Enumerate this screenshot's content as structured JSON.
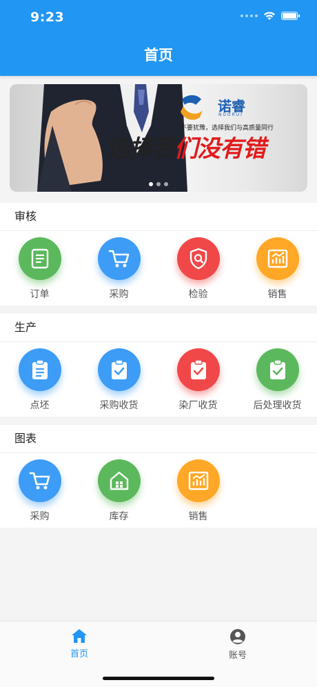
{
  "status_bar": {
    "time": "9:23"
  },
  "nav": {
    "title": "首页"
  },
  "banner": {
    "logo_text": "诺睿",
    "logo_sub": "NUORUI",
    "tagline": "不要犹豫，选择我们与高质量同行",
    "slogan_part1": "选择我",
    "slogan_part2": "们没有错",
    "page_count": 3,
    "active_page": 1
  },
  "sections": [
    {
      "title": "审核",
      "items": [
        {
          "label": "订单",
          "icon": "document-icon",
          "color": "#5cb85c"
        },
        {
          "label": "采购",
          "icon": "cart-icon",
          "color": "#3d9cf5"
        },
        {
          "label": "检验",
          "icon": "shield-search-icon",
          "color": "#f04848"
        },
        {
          "label": "销售",
          "icon": "chart-icon",
          "color": "#ffa726"
        }
      ]
    },
    {
      "title": "生产",
      "items": [
        {
          "label": "点坯",
          "icon": "clipboard-list-icon",
          "color": "#3d9cf5"
        },
        {
          "label": "采购收货",
          "icon": "clipboard-check-icon",
          "color": "#3d9cf5"
        },
        {
          "label": "染厂收货",
          "icon": "clipboard-check-icon",
          "color": "#f04848"
        },
        {
          "label": "后处理收货",
          "icon": "clipboard-check-icon",
          "color": "#5cb85c"
        }
      ]
    },
    {
      "title": "图表",
      "items": [
        {
          "label": "采购",
          "icon": "cart-icon",
          "color": "#3d9cf5"
        },
        {
          "label": "库存",
          "icon": "warehouse-icon",
          "color": "#5cb85c"
        },
        {
          "label": "销售",
          "icon": "chart-icon",
          "color": "#ffa726"
        }
      ]
    }
  ],
  "tab_bar": {
    "home_label": "首页",
    "account_label": "账号",
    "active_color": "#2196f3",
    "inactive_color": "#555555"
  }
}
